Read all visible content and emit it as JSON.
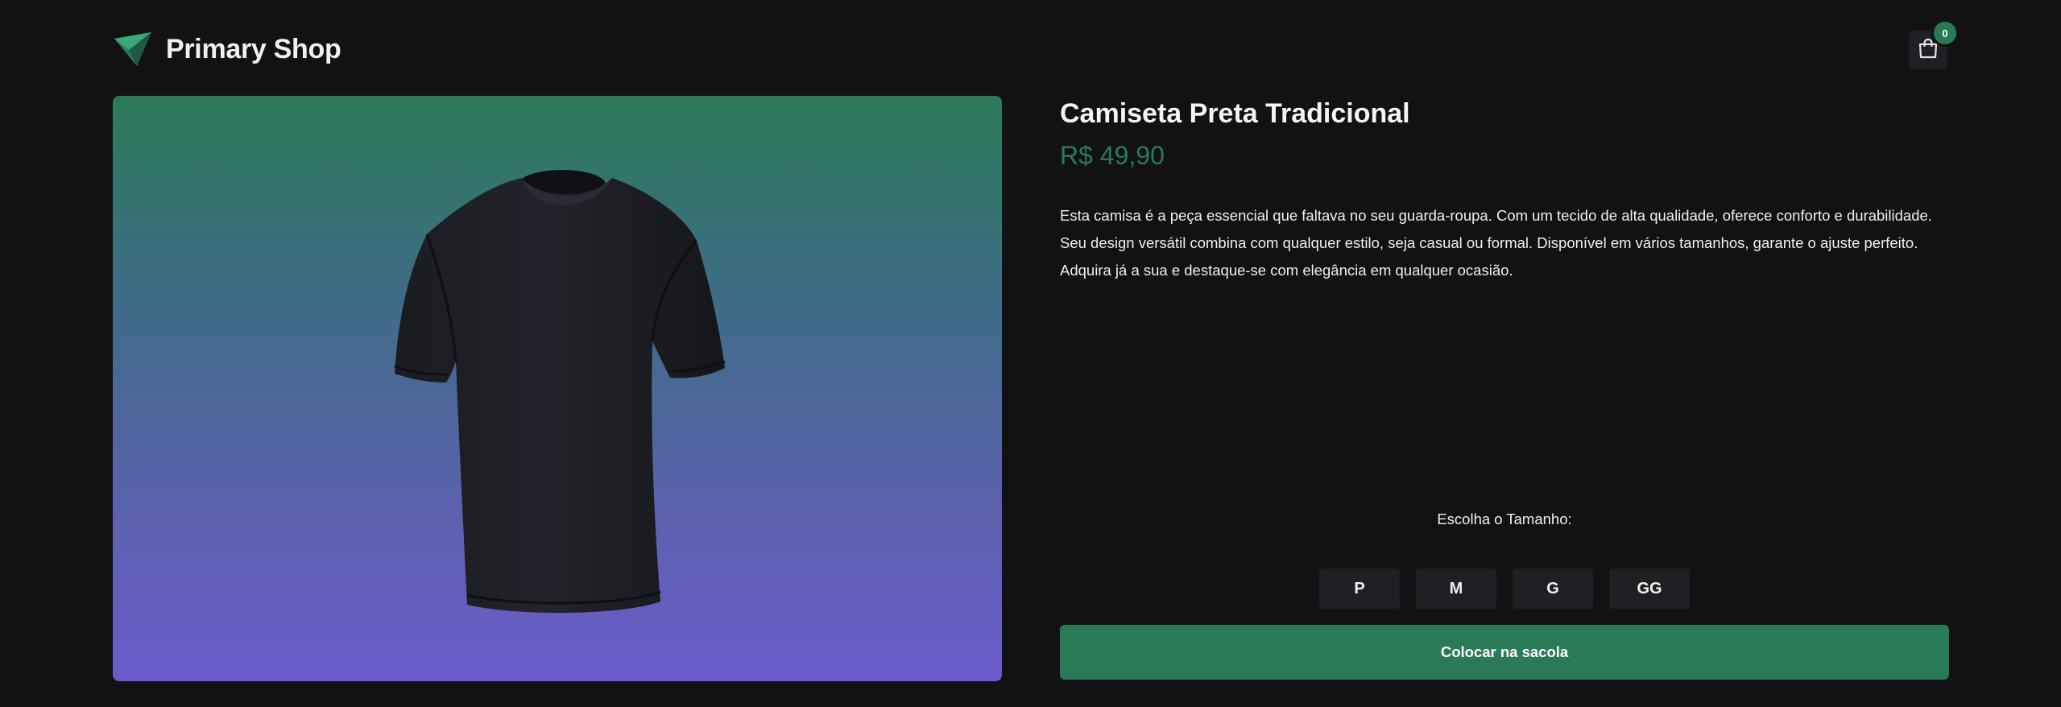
{
  "header": {
    "brand": "Primary Shop",
    "logo_icon": "paper-plane-logo-icon",
    "cart_icon": "shopping-bag-icon",
    "cart_count": "0"
  },
  "product": {
    "image_alt": "black-tshirt-image",
    "title": "Camiseta Preta Tradicional",
    "price": "R$ 49,90",
    "description": "Esta camisa é a peça essencial que faltava no seu guarda-roupa. Com um tecido de alta qualidade, oferece conforto e durabilidade. Seu design versátil combina com qualquer estilo, seja casual ou formal. Disponível em vários tamanhos, garante o ajuste perfeito. Adquira já a sua e destaque-se com elegância em qualquer ocasião.",
    "size_label": "Escolha o Tamanho:",
    "sizes": [
      "P",
      "M",
      "G",
      "GG"
    ],
    "add_to_bag_label": "Colocar na sacola"
  },
  "colors": {
    "background": "#121214",
    "accent": "#2a7a58",
    "surface": "#202024",
    "gradient_top": "#2b7a58",
    "gradient_bottom": "#6b5bcb"
  }
}
